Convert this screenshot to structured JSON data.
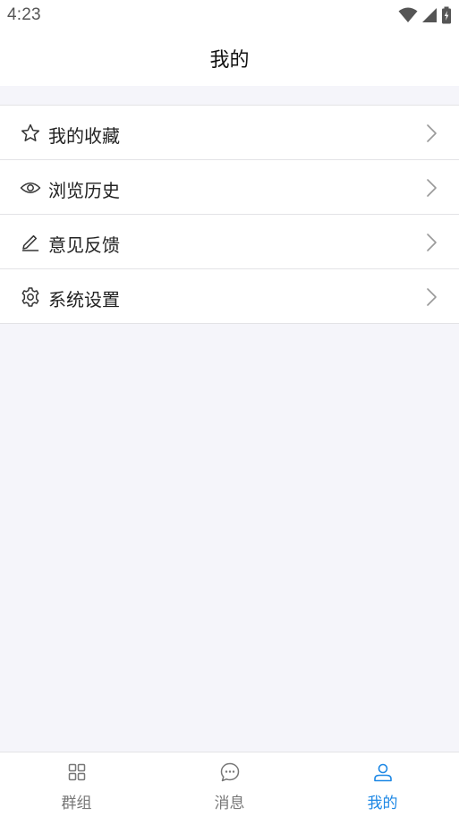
{
  "status_bar": {
    "time": "4:23",
    "icons": [
      "wifi-icon",
      "signal-icon",
      "battery-icon"
    ]
  },
  "header": {
    "title": "我的"
  },
  "menu": {
    "items": [
      {
        "label": "我的收藏",
        "icon": "star-icon"
      },
      {
        "label": "浏览历史",
        "icon": "eye-icon"
      },
      {
        "label": "意见反馈",
        "icon": "pencil-icon"
      },
      {
        "label": "系统设置",
        "icon": "gear-icon"
      }
    ],
    "chevron_icon": "chevron-right-icon"
  },
  "tabs": {
    "items": [
      {
        "label": "群组",
        "icon": "grid-icon",
        "active": false
      },
      {
        "label": "消息",
        "icon": "chat-bubble-icon",
        "active": false
      },
      {
        "label": "我的",
        "icon": "person-icon",
        "active": true
      }
    ],
    "active_color": "#1e88e5",
    "inactive_color": "#777777"
  }
}
